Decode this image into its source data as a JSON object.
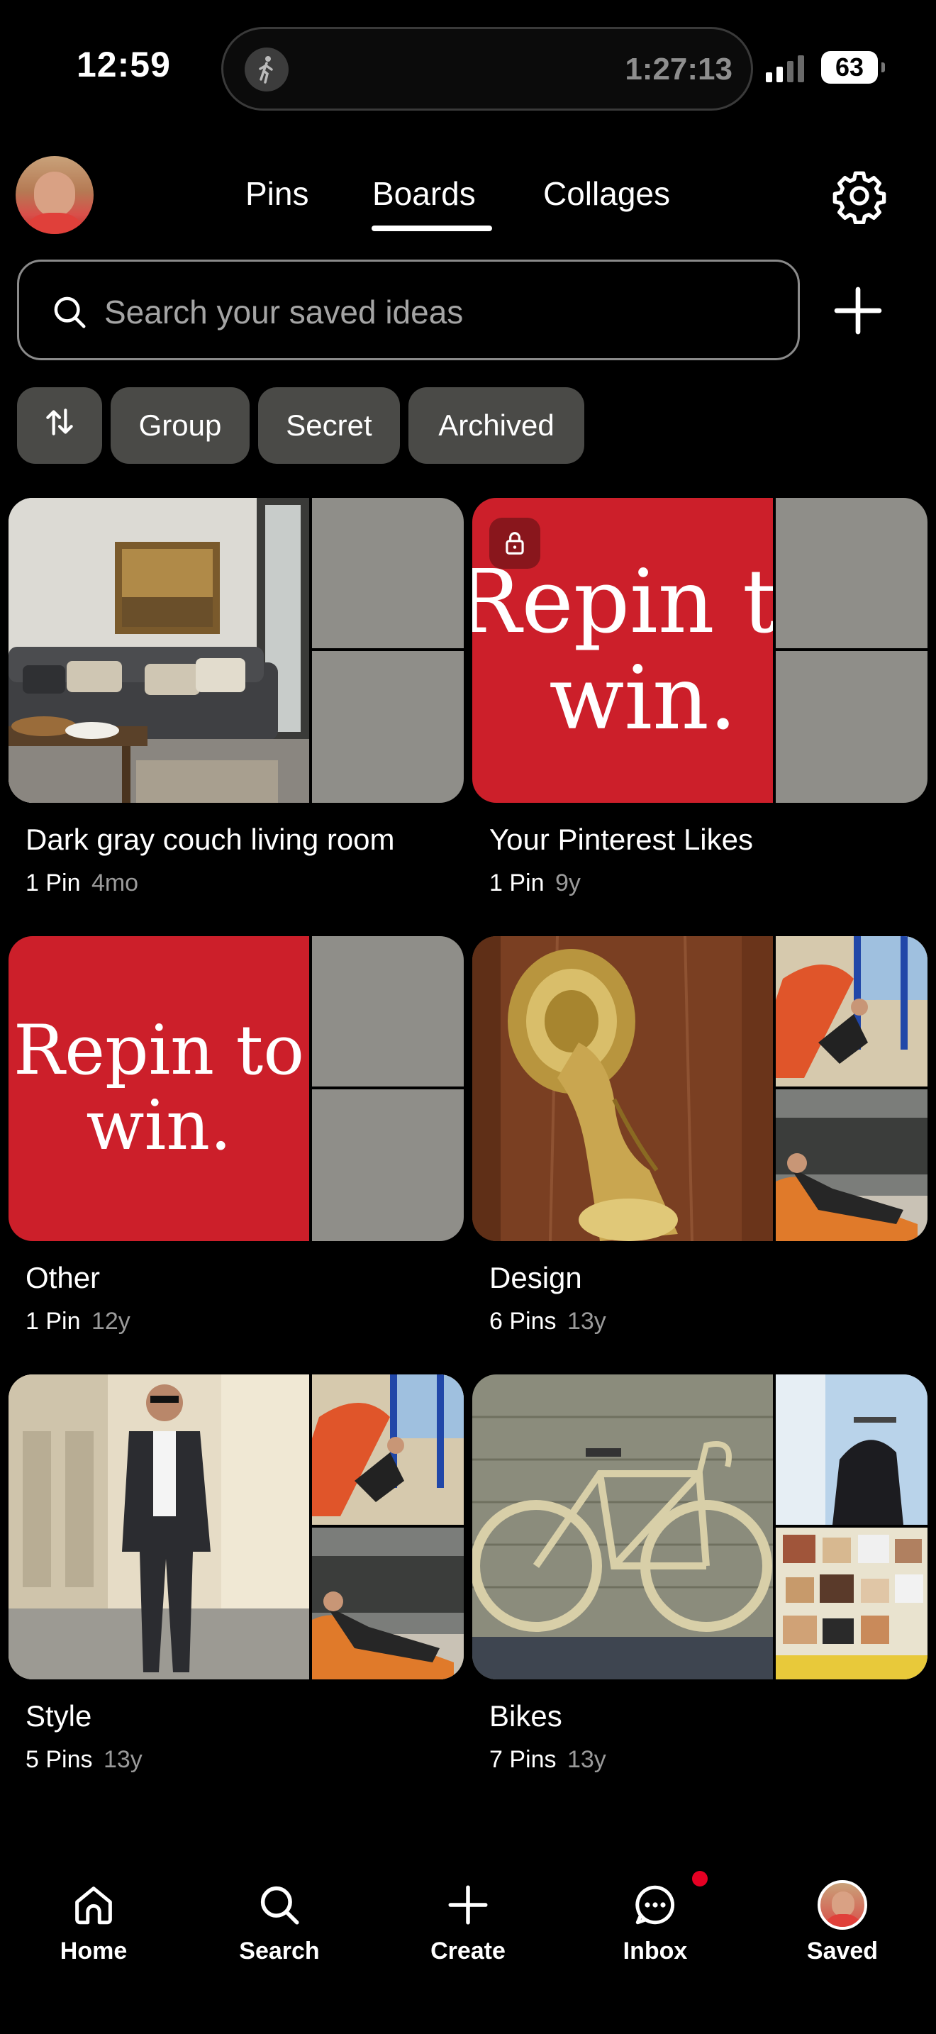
{
  "status_bar": {
    "time": "12:59",
    "timer": "1:27:13",
    "battery": "63"
  },
  "header": {
    "tabs": [
      {
        "label": "Pins"
      },
      {
        "label": "Boards"
      },
      {
        "label": "Collages"
      }
    ],
    "active_tab": "Boards"
  },
  "search": {
    "placeholder": "Search your saved ideas"
  },
  "filters": [
    {
      "label": "Group"
    },
    {
      "label": "Secret"
    },
    {
      "label": "Archived"
    }
  ],
  "boards": [
    {
      "title": "Dark gray couch living room",
      "pins": "1 Pin",
      "age": "4mo"
    },
    {
      "title": "Your Pinterest Likes",
      "pins": "1 Pin",
      "age": "9y",
      "cover_text_line1": "Repin to",
      "cover_text_line2": "win."
    },
    {
      "title": "Other",
      "pins": "1 Pin",
      "age": "12y",
      "cover_text_line1": "Repin to",
      "cover_text_line2": "win."
    },
    {
      "title": "Design",
      "pins": "6 Pins",
      "age": "13y"
    },
    {
      "title": "Style",
      "pins": "5 Pins",
      "age": "13y"
    },
    {
      "title": "Bikes",
      "pins": "7 Pins",
      "age": "13y"
    }
  ],
  "nav": {
    "items": [
      {
        "label": "Home",
        "icon": "home-icon"
      },
      {
        "label": "Search",
        "icon": "search-icon"
      },
      {
        "label": "Create",
        "icon": "plus-icon"
      },
      {
        "label": "Inbox",
        "icon": "chat-icon"
      },
      {
        "label": "Saved",
        "icon": "avatar"
      }
    ]
  },
  "colors": {
    "accent_red": "#cc1f2a",
    "chip_bg": "#4a4a47",
    "notification": "#e60023"
  }
}
